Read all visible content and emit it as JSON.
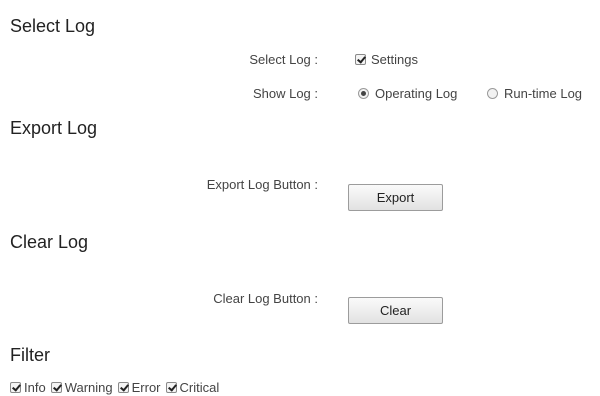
{
  "sections": {
    "select_log": "Select Log",
    "export_log": "Export Log",
    "clear_log": "Clear Log",
    "filter": "Filter"
  },
  "select_log": {
    "label": "Select Log :",
    "settings_option": "Settings",
    "settings_checked": true
  },
  "show_log": {
    "label": "Show Log :",
    "options": [
      "Operating Log",
      "Run-time Log"
    ],
    "selected": "Operating Log"
  },
  "export": {
    "label": "Export Log Button :",
    "button": "Export"
  },
  "clear": {
    "label": "Clear Log Button :",
    "button": "Clear"
  },
  "filter": {
    "items": [
      "Info",
      "Warning",
      "Error",
      "Critical"
    ],
    "checked": [
      true,
      true,
      true,
      true
    ]
  }
}
